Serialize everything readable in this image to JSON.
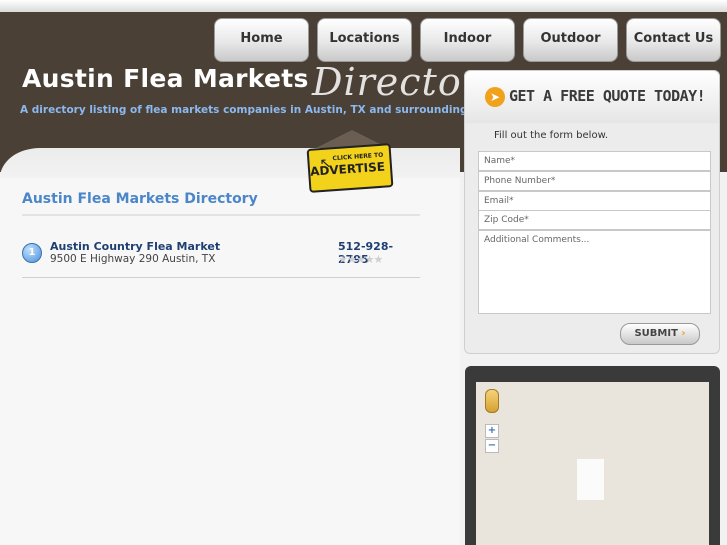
{
  "nav": {
    "items": [
      "Home",
      "Locations",
      "Indoor",
      "Outdoor",
      "Contact Us"
    ]
  },
  "header": {
    "title": "Austin Flea Markets",
    "script": "Directory",
    "tagline": "A directory listing of flea markets companies in Austin, TX and surrounding areas"
  },
  "advertise": {
    "small": "CLICK HERE TO",
    "big": "ADVERTISE"
  },
  "main": {
    "section_title": "Austin Flea Markets Directory",
    "listings": [
      {
        "number": "1",
        "name": "Austin Country Flea Market",
        "address": "9500 E Highway 290 Austin, TX",
        "phone": "512-928-2795",
        "rating": 0
      }
    ]
  },
  "quote": {
    "title": "GET A FREE QUOTE TODAY!",
    "instructions": "Fill out the form below.",
    "placeholders": {
      "name": "Name*",
      "phone": "Phone Number*",
      "email": "Email*",
      "zip": "Zip Code*",
      "comments": "Additional Comments..."
    },
    "submit": "SUBMIT"
  },
  "colors": {
    "header_bg": "#4a4036",
    "accent_blue": "#4a86c8",
    "link_navy": "#1f3f73",
    "orange": "#f0a21a"
  }
}
